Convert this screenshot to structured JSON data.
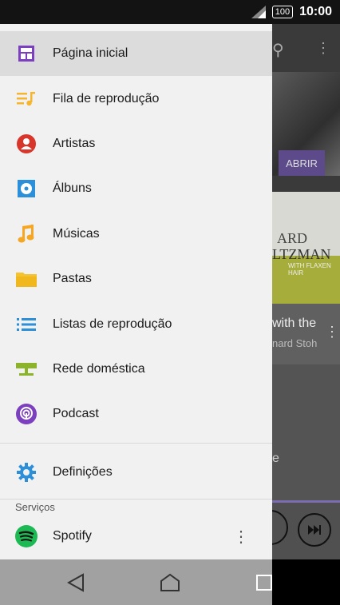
{
  "status_bar": {
    "battery": "100",
    "time": "10:00"
  },
  "background_app": {
    "open_button": "ABRIR",
    "album_line1": "ARD",
    "album_line2": "LTZMAN",
    "album_line3": "WITH FLAXEN HAIR",
    "track_title": "with the",
    "track_artist": "nard Stoh",
    "partial_text": "e"
  },
  "drawer": {
    "items": [
      {
        "label": "Página inicial",
        "icon": "home-grid-icon",
        "color": "#7b3fbf",
        "selected": true
      },
      {
        "label": "Fila de reprodução",
        "icon": "queue-icon",
        "color": "#f5b52e",
        "selected": false
      },
      {
        "label": "Artistas",
        "icon": "artist-icon",
        "color": "#d9362b",
        "selected": false
      },
      {
        "label": "Álbuns",
        "icon": "album-icon",
        "color": "#2b8fd9",
        "selected": false
      },
      {
        "label": "Músicas",
        "icon": "music-note-icon",
        "color": "#f5a623",
        "selected": false
      },
      {
        "label": "Pastas",
        "icon": "folder-icon",
        "color": "#f5c330",
        "selected": false
      },
      {
        "label": "Listas de reprodução",
        "icon": "playlist-icon",
        "color": "#2b8fd9",
        "selected": false
      },
      {
        "label": "Rede doméstica",
        "icon": "home-network-icon",
        "color": "#8bb42a",
        "selected": false
      },
      {
        "label": "Podcast",
        "icon": "podcast-icon",
        "color": "#7b3fbf",
        "selected": false
      }
    ],
    "settings_label": "Definições",
    "services_header": "Serviços",
    "spotify_label": "Spotify"
  },
  "colors": {
    "drawer_bg": "#f1f1f1",
    "selected_bg": "#dcdcdc",
    "spotify_green": "#1db954",
    "settings_blue": "#2b8fd9"
  }
}
